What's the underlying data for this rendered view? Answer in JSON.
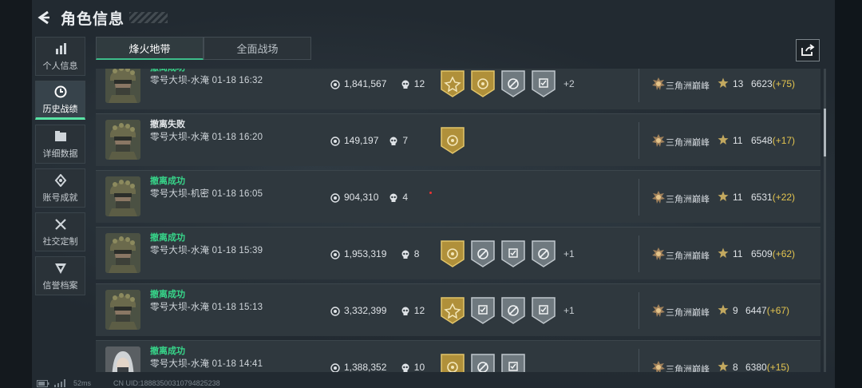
{
  "header": {
    "title": "角色信息"
  },
  "nav": [
    {
      "label": "个人信息",
      "icon": "bar-chart-icon",
      "active": false
    },
    {
      "label": "历史战绩",
      "icon": "clock-icon",
      "active": true
    },
    {
      "label": "详细数据",
      "icon": "folder-icon",
      "active": false
    },
    {
      "label": "账号成就",
      "icon": "medal-icon",
      "active": false
    },
    {
      "label": "社交定制",
      "icon": "tools-icon",
      "active": false
    },
    {
      "label": "信誉档案",
      "icon": "shield-icon",
      "active": false
    }
  ],
  "tabs": [
    {
      "label": "烽火地带",
      "active": true
    },
    {
      "label": "全面战场",
      "active": false
    }
  ],
  "rows": [
    {
      "result": "撤离成功",
      "status": "success",
      "map": "零号大坝-水淹 01-18 16:32",
      "money": "1,841,567",
      "kills": "12",
      "badges": [
        "gold",
        "gold",
        "silver",
        "silver"
      ],
      "more": "+2",
      "rank": "三角洲巅峰",
      "level": "13",
      "score": "6623",
      "delta": "(+75)",
      "avatar": "soldier"
    },
    {
      "result": "撤离失败",
      "status": "fail",
      "map": "零号大坝-水淹 01-18 16:20",
      "money": "149,197",
      "kills": "7",
      "badges": [
        "gold"
      ],
      "more": "",
      "rank": "三角洲巅峰",
      "level": "11",
      "score": "6548",
      "delta": "(+17)",
      "avatar": "soldier"
    },
    {
      "result": "撤离成功",
      "status": "success",
      "map": "零号大坝-机密 01-18 16:05",
      "money": "904,310",
      "kills": "4",
      "badges": [],
      "more": "",
      "rank": "三角洲巅峰",
      "level": "11",
      "score": "6531",
      "delta": "(+22)",
      "avatar": "soldier"
    },
    {
      "result": "撤离成功",
      "status": "success",
      "map": "零号大坝-水淹 01-18 15:39",
      "money": "1,953,319",
      "kills": "8",
      "badges": [
        "gold",
        "silver",
        "silver",
        "silver"
      ],
      "more": "+1",
      "rank": "三角洲巅峰",
      "level": "11",
      "score": "6509",
      "delta": "(+62)",
      "avatar": "soldier"
    },
    {
      "result": "撤离成功",
      "status": "success",
      "map": "零号大坝-水淹 01-18 15:13",
      "money": "3,332,399",
      "kills": "12",
      "badges": [
        "gold",
        "silver",
        "silver",
        "silver"
      ],
      "more": "+1",
      "rank": "三角洲巅峰",
      "level": "9",
      "score": "6447",
      "delta": "(+67)",
      "avatar": "soldier"
    },
    {
      "result": "撤离成功",
      "status": "success",
      "map": "零号大坝-水淹 01-18 14:41",
      "money": "1,388,352",
      "kills": "10",
      "badges": [
        "gold",
        "silver",
        "silver"
      ],
      "more": "",
      "rank": "三角洲巅峰",
      "level": "8",
      "score": "6380",
      "delta": "(+15)",
      "avatar": "woman"
    }
  ],
  "status_bar": {
    "ping": "52ms",
    "uid": "CN UID:18883500310794825238"
  },
  "colors": {
    "accent_green": "#37d68a",
    "delta_yellow": "#e3c44f",
    "gold_badge": "#b0903a",
    "silver_badge": "#7a848a"
  }
}
